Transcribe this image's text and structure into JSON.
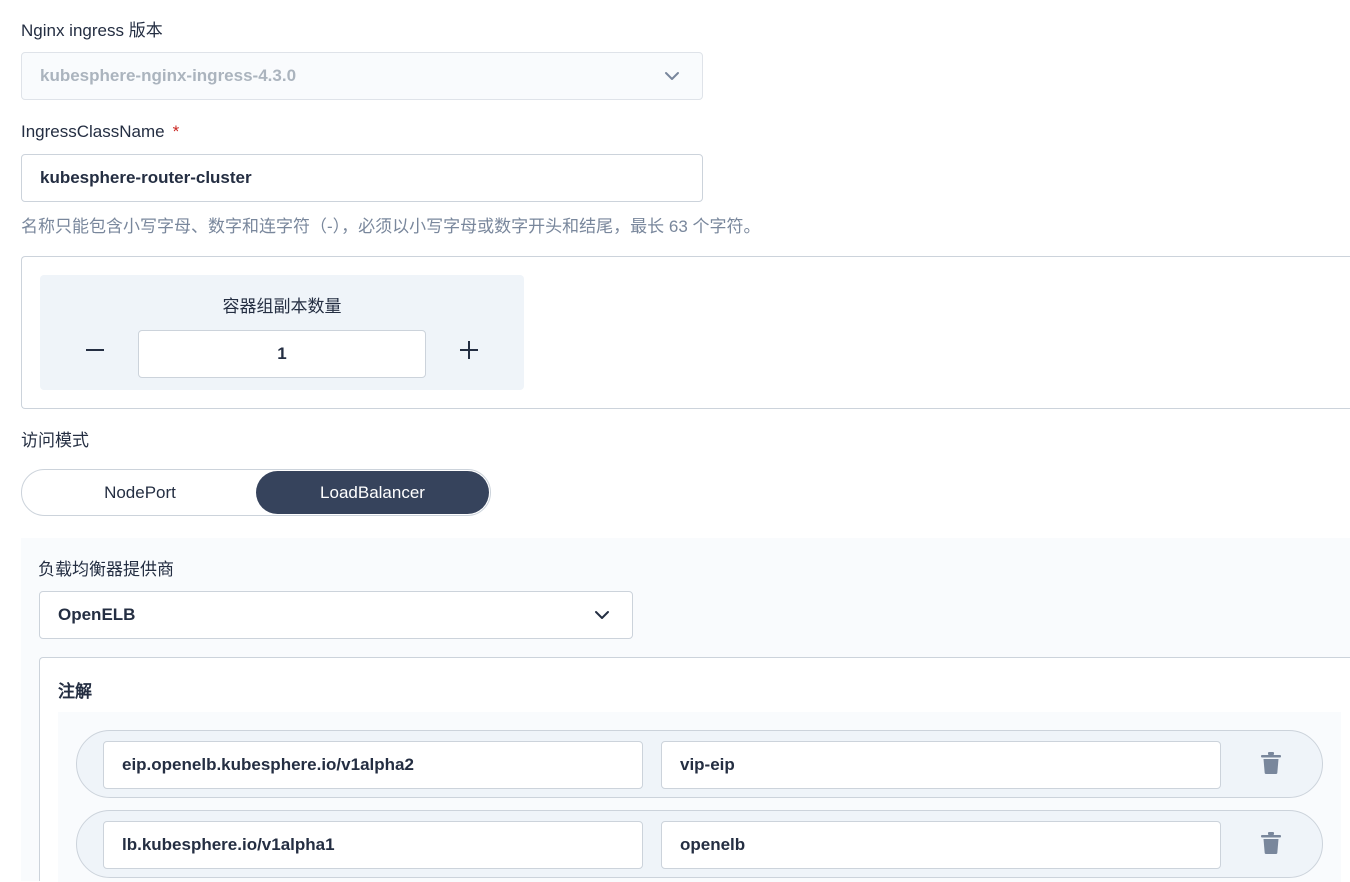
{
  "nginx_version": {
    "label": "Nginx ingress 版本",
    "value": "kubesphere-nginx-ingress-4.3.0"
  },
  "ingress_class": {
    "label": "IngressClassName",
    "required_mark": "*",
    "value": "kubesphere-router-cluster",
    "hint": "名称只能包含小写字母、数字和连字符（-），必须以小写字母或数字开头和结尾，最长 63 个字符。"
  },
  "replicas": {
    "title": "容器组副本数量",
    "value": "1",
    "decrement_icon": "minus-icon",
    "increment_icon": "plus-icon"
  },
  "access_mode": {
    "label": "访问模式",
    "options": [
      "NodePort",
      "LoadBalancer"
    ],
    "selected": "LoadBalancer"
  },
  "load_balancer": {
    "provider_label": "负载均衡器提供商",
    "provider_value": "OpenELB",
    "annotations_title": "注解",
    "annotations": [
      {
        "key": "eip.openelb.kubesphere.io/v1alpha2",
        "value": "vip-eip"
      },
      {
        "key": "lb.kubesphere.io/v1alpha1",
        "value": "openelb"
      }
    ]
  },
  "colors": {
    "primary_dark": "#36435c",
    "text": "#242e42",
    "muted": "#79879c",
    "required": "#ca2621",
    "panel_bg": "#eff4f9",
    "border": "#ccd3db"
  }
}
